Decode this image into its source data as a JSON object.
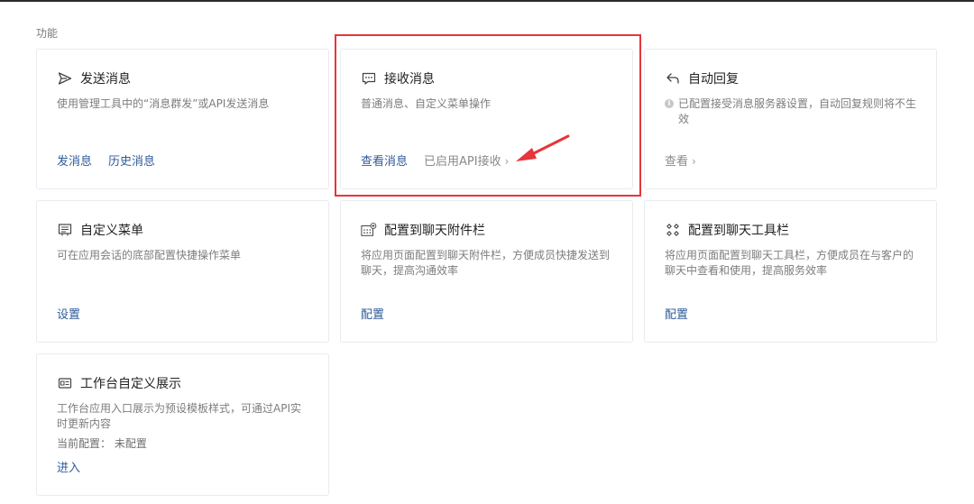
{
  "section": {
    "label": "功能"
  },
  "cards": [
    {
      "id": "send",
      "icon": "send-icon",
      "title": "发送消息",
      "desc": "使用管理工具中的“消息群发”或API发送消息",
      "links": [
        "发消息",
        "历史消息"
      ]
    },
    {
      "id": "receive",
      "icon": "chat-message-icon",
      "title": "接收消息",
      "desc": "普通消息、自定义菜单操作",
      "links": [
        "查看消息"
      ],
      "status": "已启用API接收"
    },
    {
      "id": "autoreply",
      "icon": "reply-icon",
      "title": "自动回复",
      "desc": "已配置接受消息服务器设置，自动回复规则将不生效",
      "links": [
        "查看"
      ]
    },
    {
      "id": "custom-menu",
      "icon": "menu-icon",
      "title": "自定义菜单",
      "desc": "可在应用会话的底部配置快捷操作菜单",
      "links": [
        "设置"
      ]
    },
    {
      "id": "chat-attachment",
      "icon": "attachment-bar-icon",
      "title": "配置到聊天附件栏",
      "desc": "将应用页面配置到聊天附件栏，方便成员快捷发送到聊天，提高沟通效率",
      "links": [
        "配置"
      ]
    },
    {
      "id": "chat-toolbar",
      "icon": "toolbar-icon",
      "title": "配置到聊天工具栏",
      "desc": "将应用页面配置到聊天工具栏，方便成员在与客户的聊天中查看和使用，提高服务效率",
      "links": [
        "配置"
      ]
    },
    {
      "id": "workbench",
      "icon": "workbench-icon",
      "title": "工作台自定义展示",
      "desc": "工作台应用入口展示为预设模板样式，可通过API实时更新内容",
      "config_label": "当前配置：",
      "config_value": "未配置",
      "links": [
        "进入"
      ]
    }
  ],
  "colors": {
    "link": "#2f5b99",
    "highlight": "#e5363b",
    "border": "#e8ebef"
  }
}
